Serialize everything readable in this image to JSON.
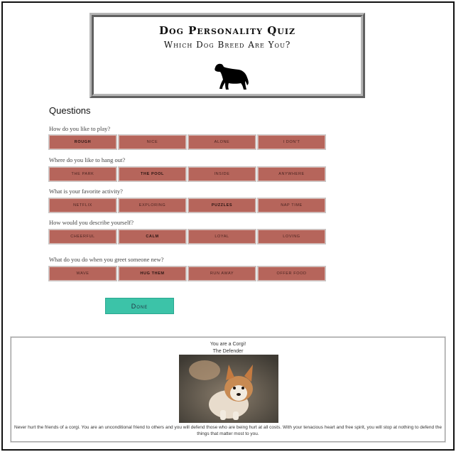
{
  "header": {
    "title": "Dog Personality Quiz",
    "subtitle": "Which Dog Breed Are You?",
    "icon": "dog-silhouette-icon"
  },
  "questions_title": "Questions",
  "questions": [
    {
      "text": "How do you like to play?",
      "options": [
        "Rough",
        "Nice",
        "Alone",
        "I don't"
      ],
      "selected": 0
    },
    {
      "text": "Where do you like to hang out?",
      "options": [
        "The park",
        "The pool",
        "Inside",
        "Anywhere"
      ],
      "selected": 1
    },
    {
      "text": "What is your favorite activity?",
      "options": [
        "Netflix",
        "Exploring",
        "Puzzles",
        "Nap time"
      ],
      "selected": 2
    },
    {
      "text": "How would you describe yourself?",
      "options": [
        "Cheerful",
        "Calm",
        "Loyal",
        "Loving"
      ],
      "selected": 1
    },
    {
      "text": "What do you do when you greet someone new?",
      "options": [
        "Wave",
        "Hug them",
        "Run away",
        "Offer food"
      ],
      "selected": 1
    }
  ],
  "done_label": "Done",
  "result": {
    "line1": "You are a Corgi!",
    "line2": "The Defender",
    "description": "Never hurt the friends of a corgi. You are an unconditional friend to others and you will defend those who are being hurt at all costs. With your tenacious heart and free spirit, you will stop at nothing to defend the things that matter most to you."
  },
  "colors": {
    "option_bg": "#b6655b",
    "done_bg": "#3cc3a8"
  }
}
